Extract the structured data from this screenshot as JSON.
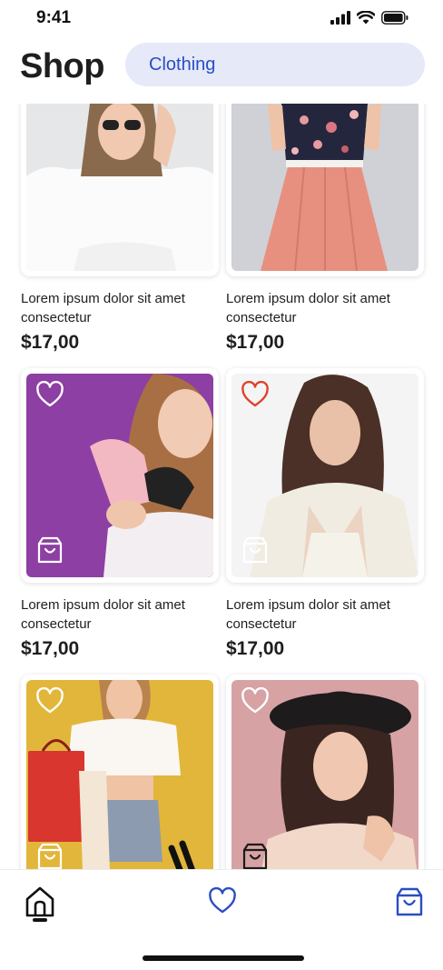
{
  "status_bar": {
    "time": "9:41",
    "icons": [
      "signal-icon",
      "wifi-icon",
      "battery-icon"
    ]
  },
  "header": {
    "title": "Shop",
    "category": "Clothing"
  },
  "products": [
    {
      "name": "Lorem ipsum dolor sit amet consectetur",
      "price": "$17,00",
      "favorited": false,
      "photo": "woman in white blouse with sunglasses"
    },
    {
      "name": "Lorem ipsum dolor sit amet consectetur",
      "price": "$17,00",
      "favorited": false,
      "photo": "floral top and coral pleated skirt"
    },
    {
      "name": "Lorem ipsum dolor sit amet consectetur",
      "price": "$17,00",
      "favorited": false,
      "photo": "woman holding sneakers on purple background"
    },
    {
      "name": "Lorem ipsum dolor sit amet consectetur",
      "price": "$17,00",
      "favorited": true,
      "photo": "woman in cream knit cardigan"
    },
    {
      "name": "",
      "price": "",
      "favorited": false,
      "photo": "woman with shopping bags on yellow background"
    },
    {
      "name": "",
      "price": "",
      "favorited": false,
      "photo": "woman in black hat on pink background"
    }
  ],
  "bottom_nav": {
    "items": [
      "home-icon",
      "heart-icon",
      "shopping-bag-icon"
    ],
    "active": "home-icon"
  },
  "colors": {
    "accent": "#2a4dc4",
    "chip_bg": "#e5e9f8",
    "favorite": "#e0412b",
    "text": "#1e1e1e"
  }
}
